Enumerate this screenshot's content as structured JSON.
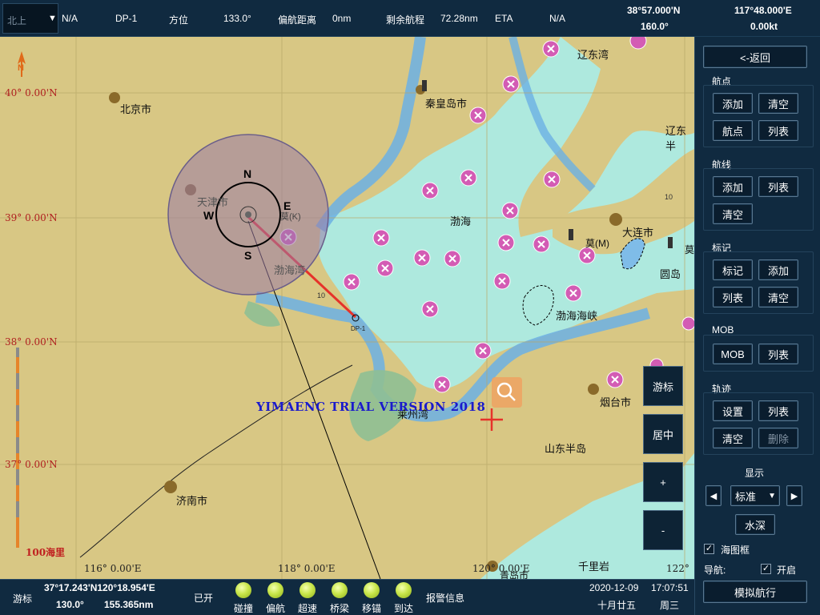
{
  "topbar": {
    "orientation": "北上",
    "eta_value": "N/A",
    "waypoint": "DP-1",
    "bearing_label": "方位",
    "bearing_value": "133.0°",
    "xte_label": "偏航距离",
    "xte_value": "0nm",
    "remaining_label": "剩余航程",
    "remaining_value": "72.28nm",
    "eta_label": "ETA",
    "eta_value2": "N/A",
    "lat": "38°57.000'N",
    "heading": "160.0°",
    "lon": "117°48.000'E",
    "speed": "0.00kt"
  },
  "map": {
    "lat_labels": [
      "40° 0.00'N",
      "39° 0.00'N",
      "38° 0.00'N",
      "37° 0.00'N"
    ],
    "lon_labels": [
      "116° 0.00'E",
      "118° 0.00'E",
      "120° 0.00'E",
      "122°"
    ],
    "places": {
      "beijing": "北京市",
      "tianjin": "天津市",
      "qinhuangdao": "秦皇岛市",
      "liaodongwan": "辽东湾",
      "liaodong": "辽东半",
      "bohai": "渤海",
      "bohaiwan": "渤海湾",
      "dalian": "大连市",
      "yuandao": "圆岛",
      "haixia": "渤海海峡",
      "laizhouwan": "莱州湾",
      "yantai": "烟台市",
      "shandong": "山东半岛",
      "jinan": "济南市",
      "qianliyan": "千里岩",
      "qingdao": "青岛市",
      "mo_m": "莫(M)",
      "mo": "莫",
      "mo_k": "莫(K)",
      "depth_a": "10",
      "depth_b": "10"
    },
    "waypoint_label": "DP-1",
    "watermark": "YIMAENC TRIAL VERSION 2018",
    "scale_label": "100海里",
    "compass": {
      "n": "N",
      "s": "S",
      "e": "E",
      "w": "W"
    },
    "north_arrow": "N",
    "buttons": {
      "cursor": "游标",
      "center": "居中",
      "zoom_in": "+",
      "zoom_out": "-"
    }
  },
  "panel": {
    "back": "<-返回",
    "waypoint_title": "航点",
    "wp_add": "添加",
    "wp_clear": "清空",
    "wp_point": "航点",
    "wp_list": "列表",
    "route_title": "航线",
    "rt_add": "添加",
    "rt_list": "列表",
    "rt_clear": "清空",
    "mark_title": "标记",
    "mk_mark": "标记",
    "mk_add": "添加",
    "mk_list": "列表",
    "mk_clear": "清空",
    "mob_title": "MOB",
    "mob_btn": "MOB",
    "mob_list": "列表",
    "track_title": "轨迹",
    "tr_set": "设置",
    "tr_list": "列表",
    "tr_clear": "清空",
    "tr_delete": "删除",
    "display_title": "显示",
    "display_mode": "标准",
    "water_depth": "水深",
    "chart_frame": "海图框",
    "nav_label": "导航:",
    "nav_on": "开启",
    "simulate": "模拟航行"
  },
  "bottombar": {
    "cursor_label": "游标",
    "cursor_pos": "37°17.243'N120°18.954'E",
    "cursor_bearing": "130.0°",
    "cursor_dist": "155.365nm",
    "opened": "已开",
    "alarms": [
      "碰撞",
      "偏航",
      "超速",
      "桥梁",
      "移锚",
      "到达"
    ],
    "alarm_info": "报警信息",
    "date": "2020-12-09",
    "time": "17:07:51",
    "lunar": "十月廿五",
    "weekday": "周三"
  },
  "colors": {
    "land": "#d8c784",
    "sea": "#aee9de",
    "shallow": "#6cb0e4",
    "panel": "#102a40",
    "accent_red": "#e6322a",
    "magenta": "#d35cb4"
  }
}
